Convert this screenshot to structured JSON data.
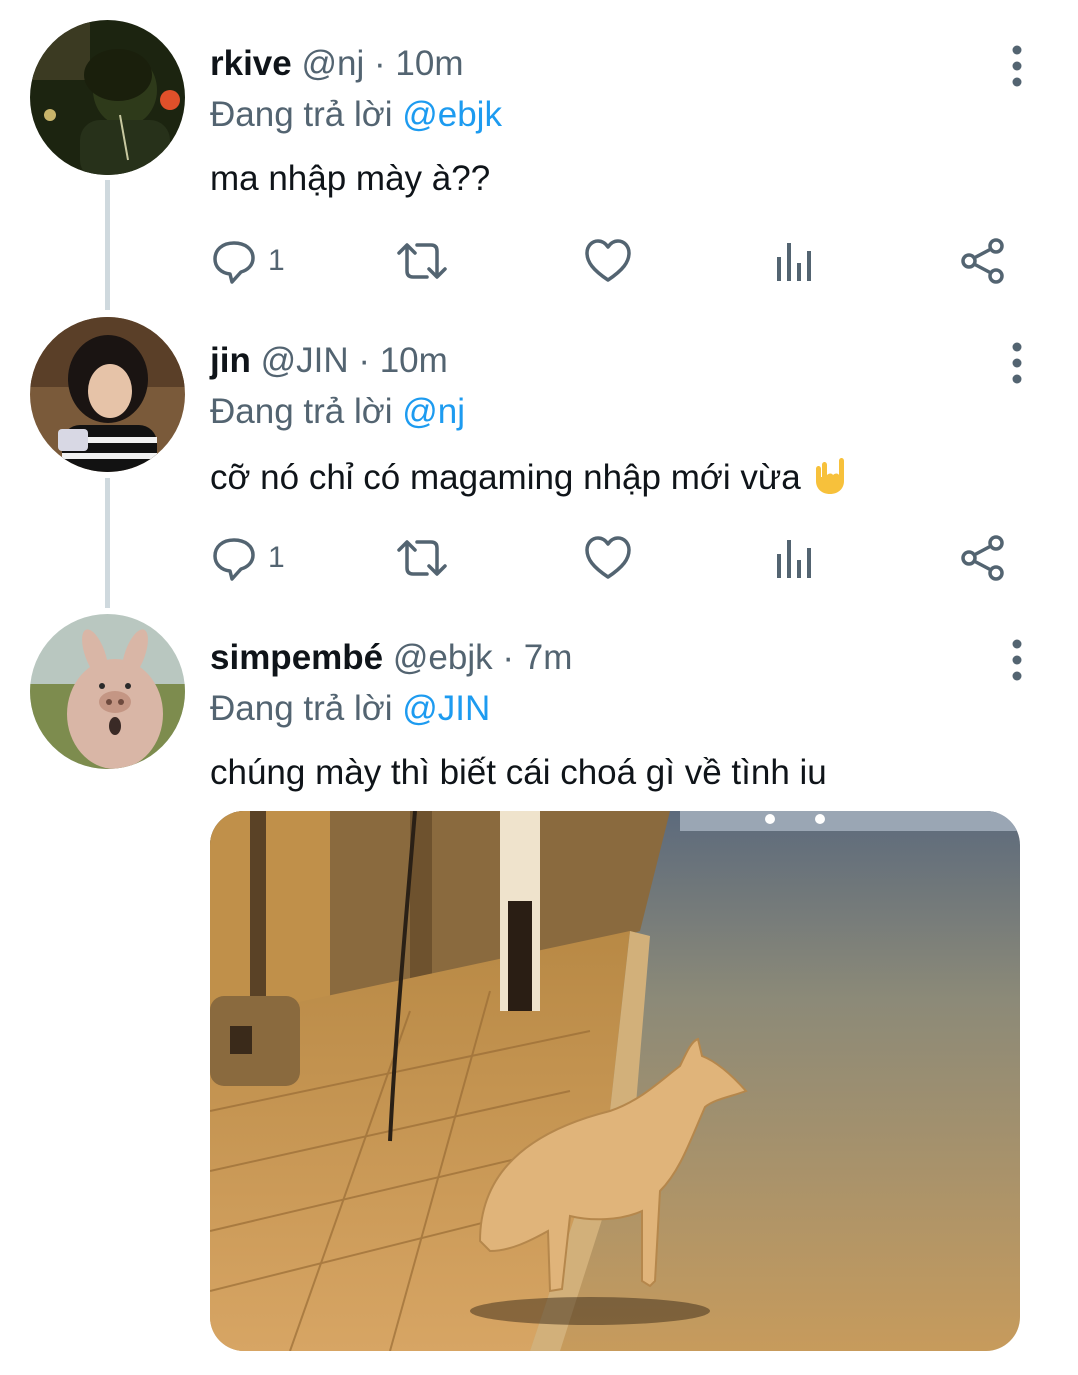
{
  "tweets": [
    {
      "name": "rkive",
      "handle": "@nj",
      "separator": "·",
      "time": "10m",
      "reply_prefix": "Đang trả lời",
      "reply_to": "@ebjk",
      "text": "ma nhập mày à??",
      "reply_count": "1"
    },
    {
      "name": "jin",
      "handle": "@JIN",
      "separator": "·",
      "time": "10m",
      "reply_prefix": "Đang trả lời",
      "reply_to": "@nj",
      "text": "cỡ nó chỉ có magaming nhập mới vừa",
      "emoji": "🤘",
      "reply_count": "1"
    },
    {
      "name": "simpembé",
      "handle": "@ebjk",
      "separator": "·",
      "time": "7m",
      "reply_prefix": "Đang trả lời",
      "reply_to": "@JIN",
      "text": "chúng mày thì biết cái choá gì về tình iu"
    }
  ],
  "icons": {
    "reply": "reply-icon",
    "retweet": "retweet-icon",
    "like": "heart-icon",
    "analytics": "analytics-icon",
    "share": "share-icon",
    "more": "more-vertical-icon"
  },
  "colors": {
    "accent": "#1d9bf0",
    "secondary_text": "#536471",
    "icon": "#536471",
    "thread_line": "#cfd9de"
  }
}
